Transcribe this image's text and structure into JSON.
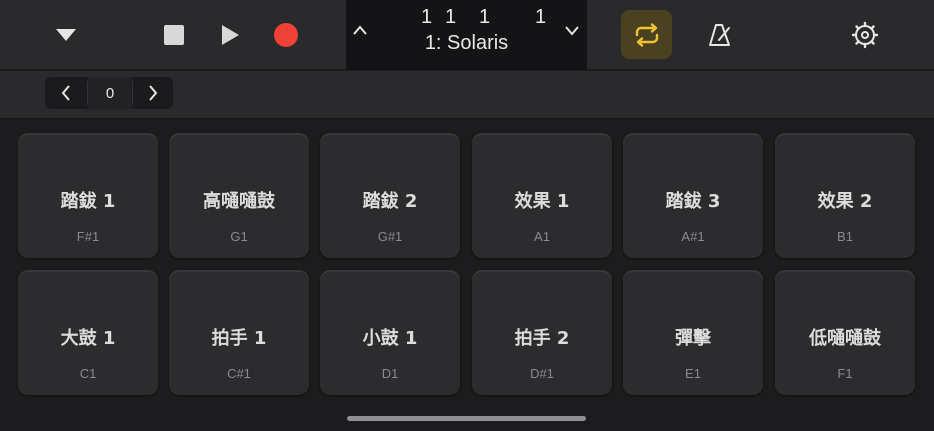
{
  "toolbar": {
    "menu_icon": "triangle-down-icon",
    "stop_icon": "stop-icon",
    "play_icon": "play-icon",
    "record_icon": "record-icon",
    "cycle_icon": "cycle-icon",
    "metronome_icon": "metronome-icon",
    "settings_icon": "gear-icon",
    "record_color": "#ef4136",
    "cycle_color": "#f3c335"
  },
  "lcd": {
    "bar": "1",
    "beat": "1",
    "division": "1",
    "tick": "1",
    "patch_name": "1: Solaris"
  },
  "stepper": {
    "value": "0"
  },
  "pads": [
    {
      "label": "踏鈸 1",
      "note": "F#1"
    },
    {
      "label": "高嗵嗵鼓",
      "note": "G1"
    },
    {
      "label": "踏鈸 2",
      "note": "G#1"
    },
    {
      "label": "效果 1",
      "note": "A1"
    },
    {
      "label": "踏鈸 3",
      "note": "A#1"
    },
    {
      "label": "效果 2",
      "note": "B1"
    },
    {
      "label": "大鼓 1",
      "note": "C1"
    },
    {
      "label": "拍手 1",
      "note": "C#1"
    },
    {
      "label": "小鼓 1",
      "note": "D1"
    },
    {
      "label": "拍手 2",
      "note": "D#1"
    },
    {
      "label": "彈擊",
      "note": "E1"
    },
    {
      "label": "低嗵嗵鼓",
      "note": "F1"
    }
  ]
}
